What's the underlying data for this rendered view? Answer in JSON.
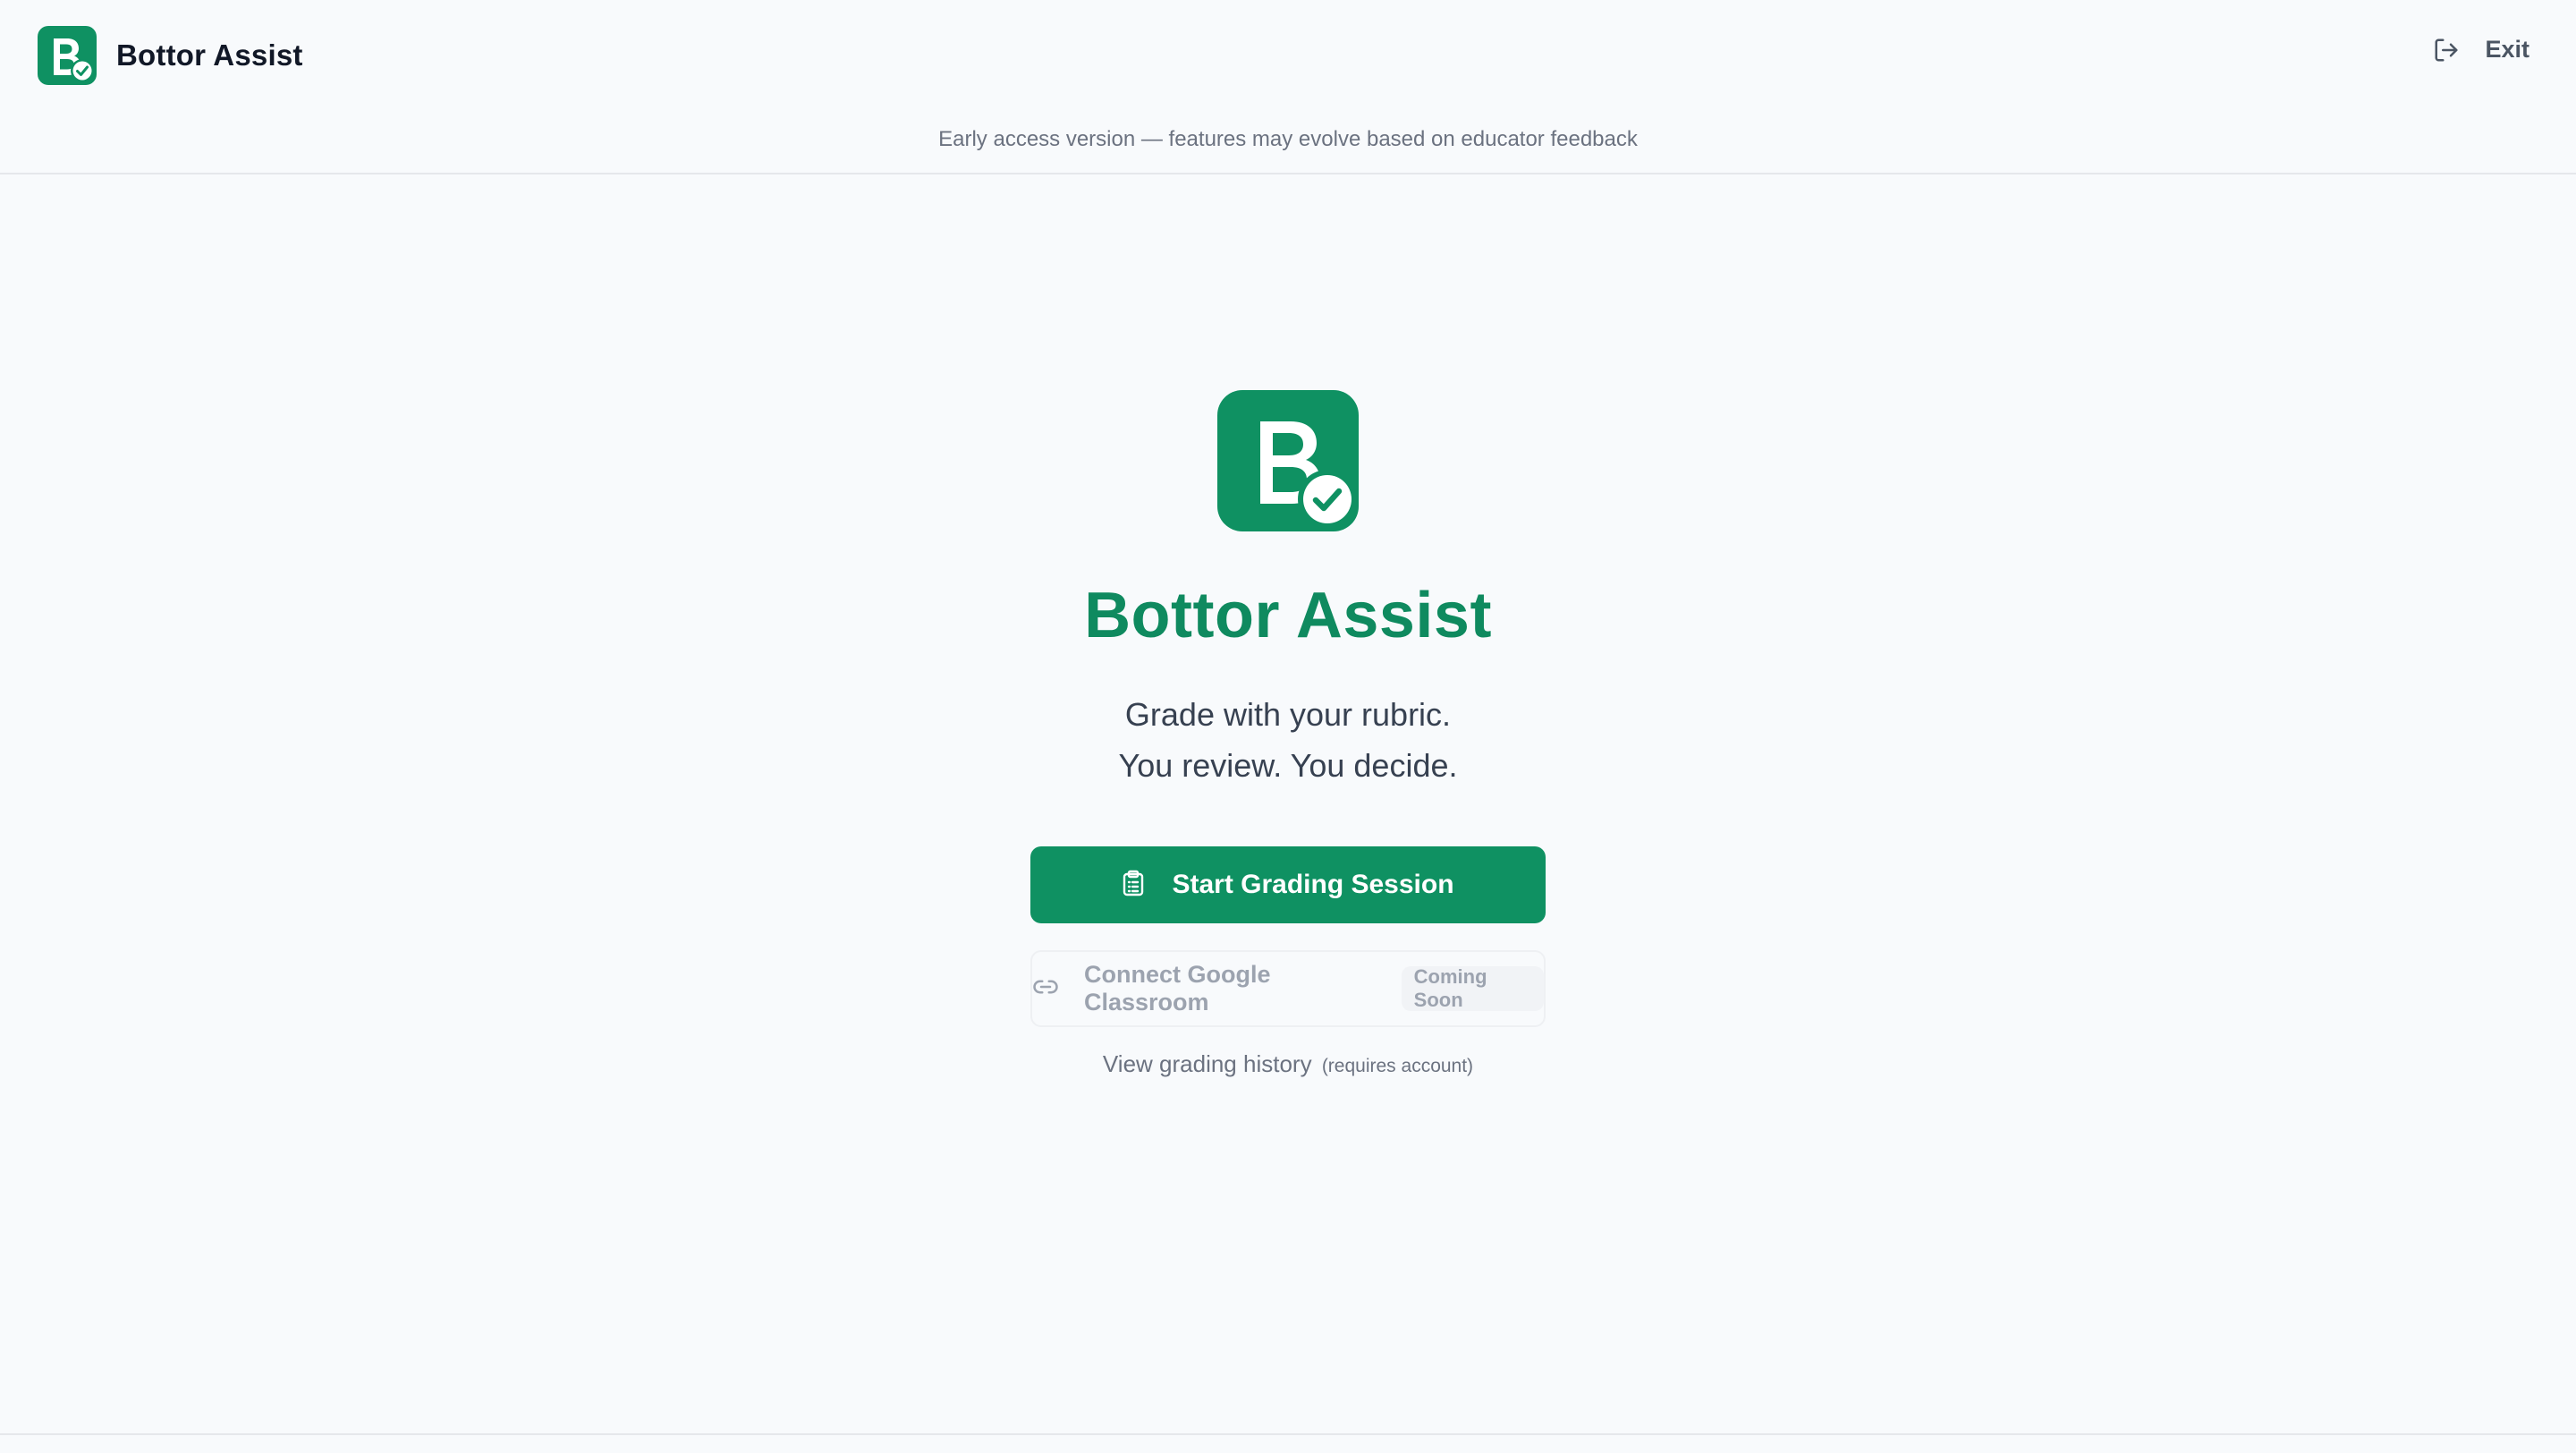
{
  "header": {
    "brand_name": "Bottor Assist",
    "exit_label": "Exit",
    "notice": "Early access version — features may evolve based on educator feedback"
  },
  "hero": {
    "title": "Bottor Assist",
    "tagline_line1": "Grade with your rubric.",
    "tagline_line2": "You review. You decide."
  },
  "actions": {
    "start_label": "Start Grading Session",
    "connect_label": "Connect Google Classroom",
    "connect_badge": "Coming Soon",
    "history_label": "View grading history",
    "history_note": "(requires account)"
  },
  "colors": {
    "brand": "#0f9162",
    "title": "#0f8a5f",
    "background": "#f8fafc"
  },
  "icons": {
    "logo": "bottor-logo-icon",
    "exit": "exit-icon",
    "start": "clipboard-icon",
    "connect": "link-icon"
  }
}
